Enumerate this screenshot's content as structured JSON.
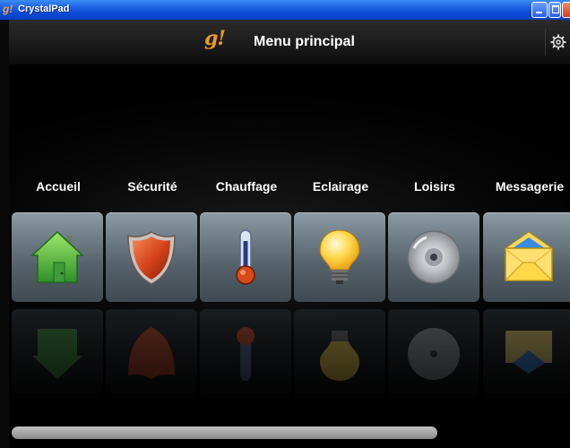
{
  "window": {
    "title": "CrystalPad"
  },
  "header": {
    "logo": "g!",
    "title": "Menu principal"
  },
  "menu": {
    "items": [
      {
        "label": "Accueil",
        "icon": "house-icon"
      },
      {
        "label": "Sécurité",
        "icon": "shield-icon"
      },
      {
        "label": "Chauffage",
        "icon": "thermometer-icon"
      },
      {
        "label": "Eclairage",
        "icon": "lightbulb-icon"
      },
      {
        "label": "Loisirs",
        "icon": "disc-icon"
      },
      {
        "label": "Messagerie",
        "icon": "envelope-icon"
      }
    ]
  },
  "colors": {
    "accent": "#e89a28",
    "titlebar": "#0a49d6"
  }
}
